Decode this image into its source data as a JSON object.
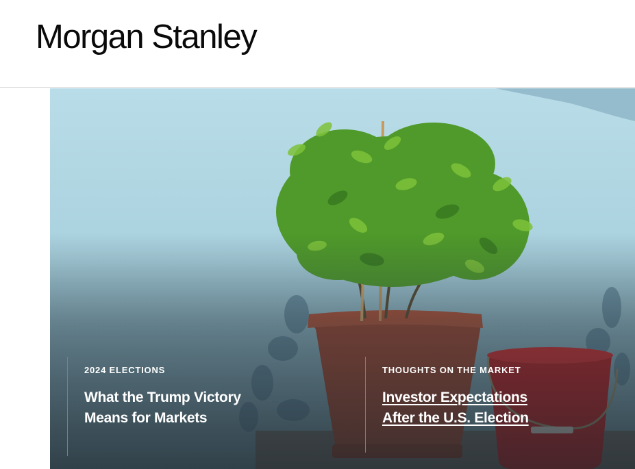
{
  "brand": {
    "name": "Morgan Stanley"
  },
  "hero": {
    "image_alt": "Potted plant and red bucket against a light blue wall",
    "colors": {
      "wall": "#b9dde8",
      "pot": "#a3432a",
      "bucket": "#c41b1b",
      "leaves": "#4f9a2a",
      "accent_line": "#3d8fd6"
    }
  },
  "stories": [
    {
      "eyebrow": "2024 ELECTIONS",
      "headline": "What the Trump Victory Means for Markets"
    },
    {
      "eyebrow": "THOUGHTS ON THE MARKET",
      "headline": "Investor Expectations After the U.S. Election"
    }
  ]
}
